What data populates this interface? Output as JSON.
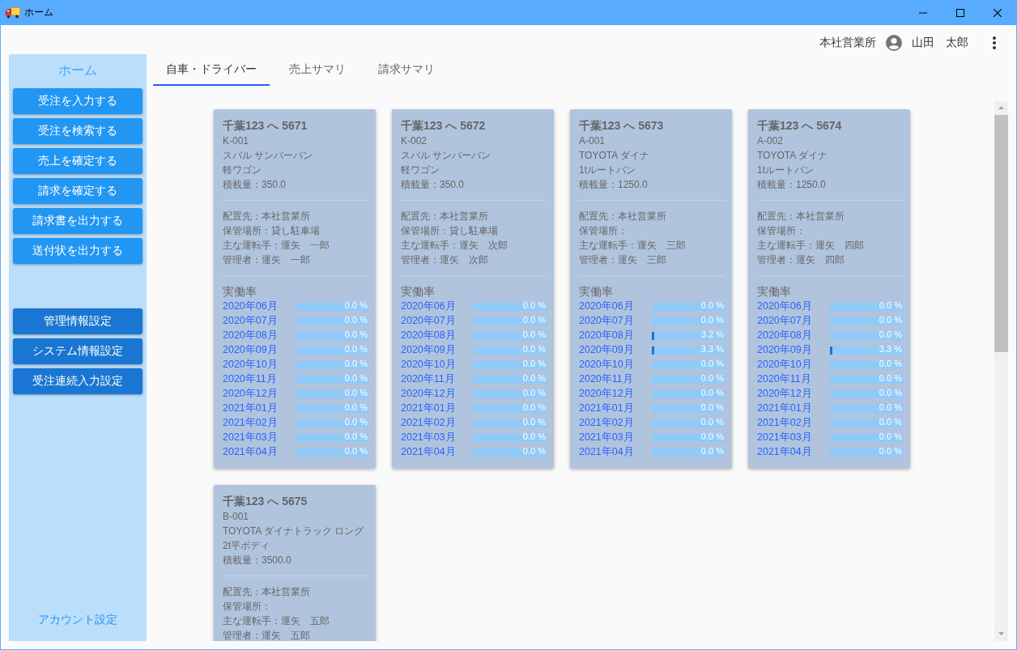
{
  "window": {
    "title": "ホーム"
  },
  "header": {
    "office": "本社営業所",
    "user": "山田　太郎"
  },
  "sidebar": {
    "title": "ホーム",
    "groups": [
      {
        "kind": "primary",
        "buttons": [
          "受注を入力する",
          "受注を検索する",
          "売上を確定する",
          "請求を確定する",
          "請求書を出力する",
          "送付状を出力する"
        ]
      },
      {
        "kind": "settings",
        "buttons": [
          "管理情報設定",
          "システム情報設定",
          "受注連続入力設定"
        ]
      }
    ],
    "footer_link": "アカウント設定"
  },
  "tabs": [
    {
      "label": "自車・ドライバー",
      "selected": true
    },
    {
      "label": "売上サマリ",
      "selected": false
    },
    {
      "label": "請求サマリ",
      "selected": false
    }
  ],
  "vehicles": [
    {
      "plate": "千葉123 へ 5671",
      "code": "K-001",
      "model": "スバル サンバーバン",
      "body": "軽ワゴン",
      "capacity": "積載量：350.0",
      "details": [
        "配置先：本社営業所",
        "保管場所：貸し駐車場",
        "主な運転手：運矢　一郎",
        "管理者：運矢　一郎"
      ],
      "utilization_title": "実働率",
      "utilization": [
        {
          "month": "2020年06月",
          "level": 0,
          "reading": "0.0 %"
        },
        {
          "month": "2020年07月",
          "level": 0,
          "reading": "0.0 %"
        },
        {
          "month": "2020年08月",
          "level": 0,
          "reading": "0.0 %"
        },
        {
          "month": "2020年09月",
          "level": 0,
          "reading": "0.0 %"
        },
        {
          "month": "2020年10月",
          "level": 0,
          "reading": "0.0 %"
        },
        {
          "month": "2020年11月",
          "level": 0,
          "reading": "0.0 %"
        },
        {
          "month": "2020年12月",
          "level": 0,
          "reading": "0.0 %"
        },
        {
          "month": "2021年01月",
          "level": 0,
          "reading": "0.0 %"
        },
        {
          "month": "2021年02月",
          "level": 0,
          "reading": "0.0 %"
        },
        {
          "month": "2021年03月",
          "level": 0,
          "reading": "0.0 %"
        },
        {
          "month": "2021年04月",
          "level": 0,
          "reading": "0.0 %"
        }
      ]
    },
    {
      "plate": "千葉123 へ 5672",
      "code": "K-002",
      "model": "スバル サンバーバン",
      "body": "軽ワゴン",
      "capacity": "積載量：350.0",
      "details": [
        "配置先：本社営業所",
        "保管場所：貸し駐車場",
        "主な運転手：運矢　次郎",
        "管理者：運矢　次郎"
      ],
      "utilization_title": "実働率",
      "utilization": [
        {
          "month": "2020年06月",
          "level": 0,
          "reading": "0.0 %"
        },
        {
          "month": "2020年07月",
          "level": 0,
          "reading": "0.0 %"
        },
        {
          "month": "2020年08月",
          "level": 0,
          "reading": "0.0 %"
        },
        {
          "month": "2020年09月",
          "level": 0,
          "reading": "0.0 %"
        },
        {
          "month": "2020年10月",
          "level": 0,
          "reading": "0.0 %"
        },
        {
          "month": "2020年11月",
          "level": 0,
          "reading": "0.0 %"
        },
        {
          "month": "2020年12月",
          "level": 0,
          "reading": "0.0 %"
        },
        {
          "month": "2021年01月",
          "level": 0,
          "reading": "0.0 %"
        },
        {
          "month": "2021年02月",
          "level": 0,
          "reading": "0.0 %"
        },
        {
          "month": "2021年03月",
          "level": 0,
          "reading": "0.0 %"
        },
        {
          "month": "2021年04月",
          "level": 0,
          "reading": "0.0 %"
        }
      ]
    },
    {
      "plate": "千葉123 へ 5673",
      "code": "A-001",
      "model": "TOYOTA ダイナ",
      "body": "1tルートバン",
      "capacity": "積載量：1250.0",
      "details": [
        "配置先：本社営業所",
        "保管場所：",
        "主な運転手：運矢　三郎",
        "管理者：運矢　三郎"
      ],
      "utilization_title": "実働率",
      "utilization": [
        {
          "month": "2020年06月",
          "level": 0,
          "reading": "0.0 %"
        },
        {
          "month": "2020年07月",
          "level": 0,
          "reading": "0.0 %"
        },
        {
          "month": "2020年08月",
          "level": 0.032,
          "reading": "3.2 %"
        },
        {
          "month": "2020年09月",
          "level": 0.033,
          "reading": "3.3 %"
        },
        {
          "month": "2020年10月",
          "level": 0,
          "reading": "0.0 %"
        },
        {
          "month": "2020年11月",
          "level": 0,
          "reading": "0.0 %"
        },
        {
          "month": "2020年12月",
          "level": 0,
          "reading": "0.0 %"
        },
        {
          "month": "2021年01月",
          "level": 0,
          "reading": "0.0 %"
        },
        {
          "month": "2021年02月",
          "level": 0,
          "reading": "0.0 %"
        },
        {
          "month": "2021年03月",
          "level": 0,
          "reading": "0.0 %"
        },
        {
          "month": "2021年04月",
          "level": 0,
          "reading": "0.0 %"
        }
      ]
    },
    {
      "plate": "千葉123 へ 5674",
      "code": "A-002",
      "model": "TOYOTA ダイナ",
      "body": "1tルートバン",
      "capacity": "積載量：1250.0",
      "details": [
        "配置先：本社営業所",
        "保管場所：",
        "主な運転手：運矢　四郎",
        "管理者：運矢　四郎"
      ],
      "utilization_title": "実働率",
      "utilization": [
        {
          "month": "2020年06月",
          "level": 0,
          "reading": "0.0 %"
        },
        {
          "month": "2020年07月",
          "level": 0,
          "reading": "0.0 %"
        },
        {
          "month": "2020年08月",
          "level": 0,
          "reading": "0.0 %"
        },
        {
          "month": "2020年09月",
          "level": 0.033,
          "reading": "3.3 %"
        },
        {
          "month": "2020年10月",
          "level": 0,
          "reading": "0.0 %"
        },
        {
          "month": "2020年11月",
          "level": 0,
          "reading": "0.0 %"
        },
        {
          "month": "2020年12月",
          "level": 0,
          "reading": "0.0 %"
        },
        {
          "month": "2021年01月",
          "level": 0,
          "reading": "0.0 %"
        },
        {
          "month": "2021年02月",
          "level": 0,
          "reading": "0.0 %"
        },
        {
          "month": "2021年03月",
          "level": 0,
          "reading": "0.0 %"
        },
        {
          "month": "2021年04月",
          "level": 0,
          "reading": "0.0 %"
        }
      ]
    },
    {
      "plate": "千葉123 へ 5675",
      "code": "B-001",
      "model": "TOYOTA ダイナトラック ロング",
      "body": "2t平ボディ",
      "capacity": "積載量：3500.0",
      "details": [
        "配置先：本社営業所",
        "保管場所：",
        "主な運転手：運矢　五郎",
        "管理者：運矢　五郎"
      ]
    }
  ]
}
